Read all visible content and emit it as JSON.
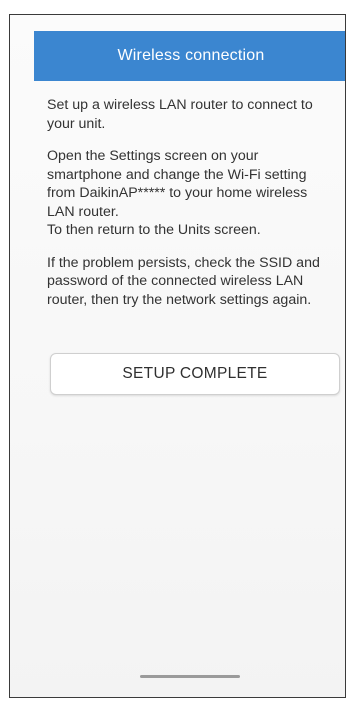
{
  "header": {
    "title": "Wireless connection",
    "bg_color": "#3b86d0"
  },
  "content": {
    "paragraphs": [
      "Set up a wireless LAN router to connect to your unit.",
      "Open the Settings screen on your smartphone and change the Wi-Fi setting from DaikinAP***** to your home wireless LAN router.\nTo then return to the Units screen.",
      "If the problem persists, check the SSID and password of the connected wireless LAN router, then try the network settings again."
    ]
  },
  "actions": {
    "setup_complete_label": "SETUP COMPLETE"
  }
}
